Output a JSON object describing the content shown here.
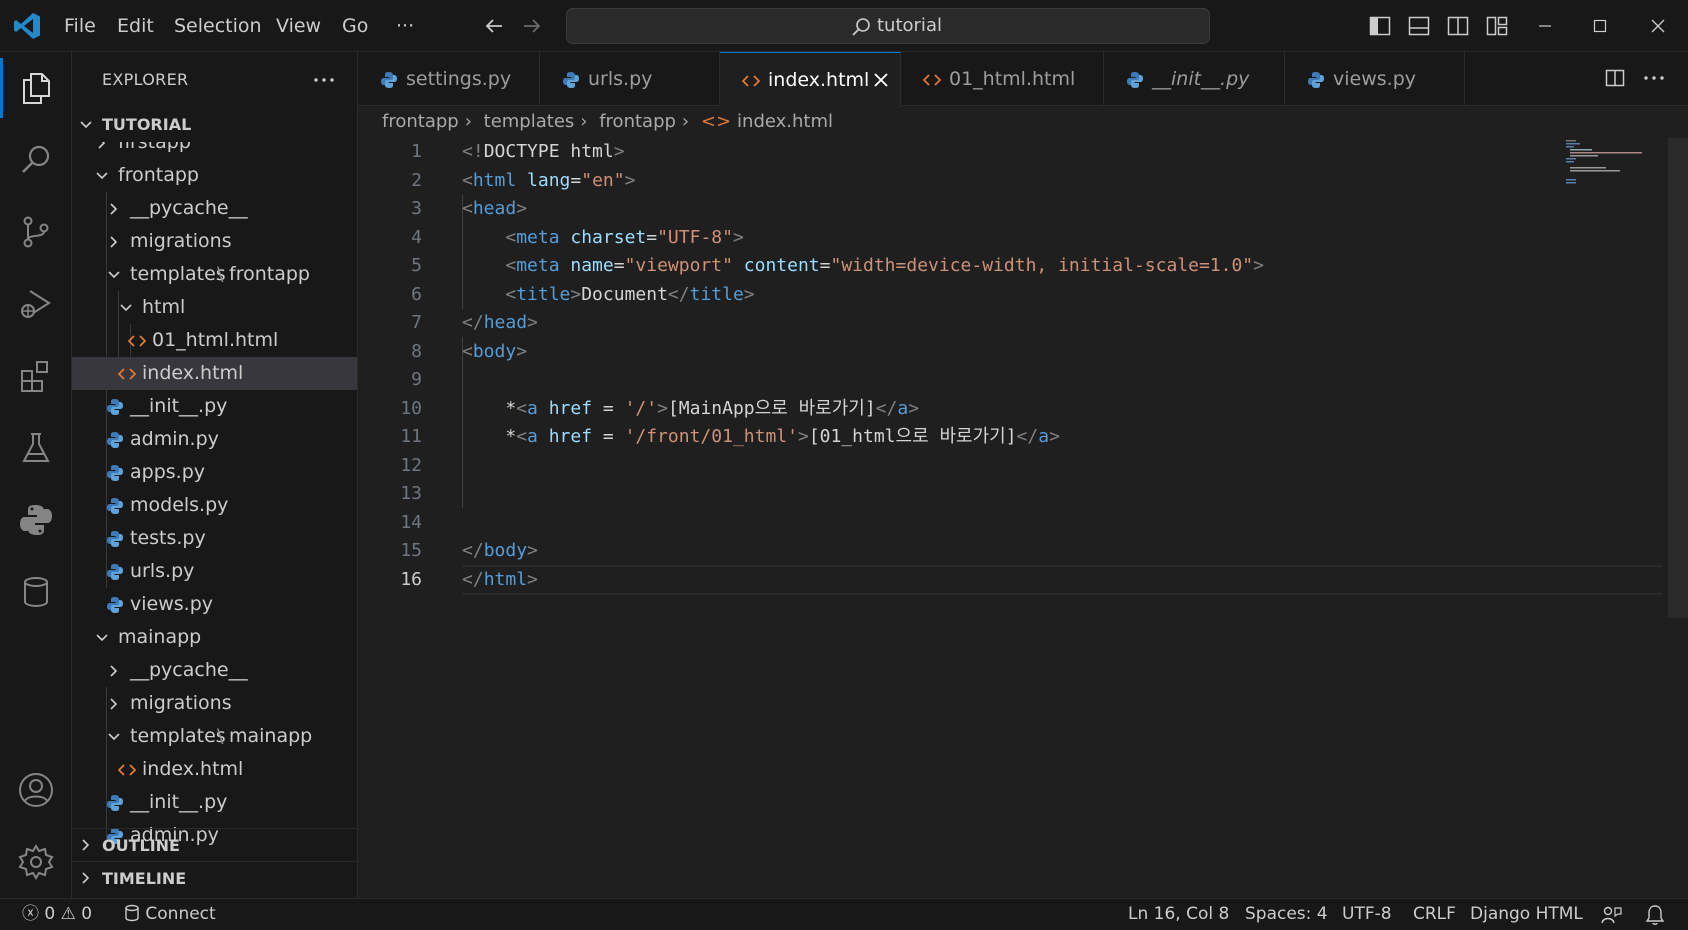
{
  "titlebar": {
    "menus": [
      "File",
      "Edit",
      "Selection",
      "View",
      "Go",
      "···"
    ],
    "search_text": "tutorial",
    "accent": "#0078d4"
  },
  "explorer": {
    "title": "EXPLORER",
    "section": "TUTORIAL",
    "tree": [
      {
        "label": "firstapp",
        "kind": "folder",
        "open": false,
        "depth": 1,
        "clipped": true
      },
      {
        "label": "frontapp",
        "kind": "folder",
        "open": true,
        "depth": 1
      },
      {
        "label": "__pycache__",
        "kind": "folder",
        "open": false,
        "depth": 2
      },
      {
        "label": "migrations",
        "kind": "folder",
        "open": false,
        "depth": 2
      },
      {
        "label": "templates",
        "label2": "frontapp",
        "kind": "folder",
        "open": true,
        "depth": 2
      },
      {
        "label": "html",
        "kind": "folder",
        "open": true,
        "depth": 3
      },
      {
        "label": "01_html.html",
        "kind": "html",
        "depth": 4
      },
      {
        "label": "index.html",
        "kind": "html",
        "depth": 3,
        "selected": true
      },
      {
        "label": "__init__.py",
        "kind": "py",
        "depth": 2
      },
      {
        "label": "admin.py",
        "kind": "py",
        "depth": 2
      },
      {
        "label": "apps.py",
        "kind": "py",
        "depth": 2
      },
      {
        "label": "models.py",
        "kind": "py",
        "depth": 2
      },
      {
        "label": "tests.py",
        "kind": "py",
        "depth": 2
      },
      {
        "label": "urls.py",
        "kind": "py",
        "depth": 2
      },
      {
        "label": "views.py",
        "kind": "py",
        "depth": 2
      },
      {
        "label": "mainapp",
        "kind": "folder",
        "open": true,
        "depth": 1
      },
      {
        "label": "__pycache__",
        "kind": "folder",
        "open": false,
        "depth": 2
      },
      {
        "label": "migrations",
        "kind": "folder",
        "open": false,
        "depth": 2
      },
      {
        "label": "templates",
        "label2": "mainapp",
        "kind": "folder",
        "open": true,
        "depth": 2
      },
      {
        "label": "index.html",
        "kind": "html",
        "depth": 3
      },
      {
        "label": "__init__.py",
        "kind": "py",
        "depth": 2
      },
      {
        "label": "admin.py",
        "kind": "py",
        "depth": 2
      }
    ],
    "outline": "OUTLINE",
    "timeline": "TIMELINE"
  },
  "tabs": [
    {
      "label": "settings.py",
      "kind": "py"
    },
    {
      "label": "urls.py",
      "kind": "py"
    },
    {
      "label": "index.html",
      "kind": "html",
      "active": true
    },
    {
      "label": "01_html.html",
      "kind": "html"
    },
    {
      "label": "__init__.py",
      "kind": "py",
      "italic": true
    },
    {
      "label": "views.py",
      "kind": "py"
    }
  ],
  "breadcrumb": [
    "frontapp",
    "templates",
    "frontapp",
    "index.html"
  ],
  "editor": {
    "current_line": 16,
    "lines": [
      [
        {
          "t": "<!",
          "c": "tagp"
        },
        {
          "t": "DOCTYPE",
          "c": "txt"
        },
        {
          "t": " html",
          "c": "txt"
        },
        {
          "t": ">",
          "c": "tagp"
        }
      ],
      [
        {
          "t": "<",
          "c": "tagp"
        },
        {
          "t": "html",
          "c": "tagn"
        },
        {
          "t": " lang",
          "c": "attr"
        },
        {
          "t": "=",
          "c": "txt"
        },
        {
          "t": "\"en\"",
          "c": "str"
        },
        {
          "t": ">",
          "c": "tagp"
        }
      ],
      [
        {
          "t": "<",
          "c": "tagp"
        },
        {
          "t": "head",
          "c": "tagn"
        },
        {
          "t": ">",
          "c": "tagp"
        }
      ],
      [
        {
          "t": "    <",
          "c": "tagp"
        },
        {
          "t": "meta",
          "c": "tagn"
        },
        {
          "t": " charset",
          "c": "attr"
        },
        {
          "t": "=",
          "c": "txt"
        },
        {
          "t": "\"UTF-8\"",
          "c": "str"
        },
        {
          "t": ">",
          "c": "tagp"
        }
      ],
      [
        {
          "t": "    <",
          "c": "tagp"
        },
        {
          "t": "meta",
          "c": "tagn"
        },
        {
          "t": " name",
          "c": "attr"
        },
        {
          "t": "=",
          "c": "txt"
        },
        {
          "t": "\"viewport\"",
          "c": "str"
        },
        {
          "t": " content",
          "c": "attr"
        },
        {
          "t": "=",
          "c": "txt"
        },
        {
          "t": "\"width=device-width, initial-scale=1.0\"",
          "c": "str"
        },
        {
          "t": ">",
          "c": "tagp"
        }
      ],
      [
        {
          "t": "    <",
          "c": "tagp"
        },
        {
          "t": "title",
          "c": "tagn"
        },
        {
          "t": ">",
          "c": "tagp"
        },
        {
          "t": "Document",
          "c": "txt"
        },
        {
          "t": "</",
          "c": "tagp"
        },
        {
          "t": "title",
          "c": "tagn"
        },
        {
          "t": ">",
          "c": "tagp"
        }
      ],
      [
        {
          "t": "</",
          "c": "tagp"
        },
        {
          "t": "head",
          "c": "tagn"
        },
        {
          "t": ">",
          "c": "tagp"
        }
      ],
      [
        {
          "t": "<",
          "c": "tagp"
        },
        {
          "t": "body",
          "c": "tagn"
        },
        {
          "t": ">",
          "c": "tagp"
        }
      ],
      [],
      [
        {
          "t": "    *",
          "c": "txt"
        },
        {
          "t": "<",
          "c": "tagp"
        },
        {
          "t": "a",
          "c": "tagn"
        },
        {
          "t": " href",
          "c": "attr"
        },
        {
          "t": " = ",
          "c": "txt"
        },
        {
          "t": "'/'",
          "c": "str"
        },
        {
          "t": ">",
          "c": "tagp"
        },
        {
          "t": "[MainApp으로 바로가기]",
          "c": "txt"
        },
        {
          "t": "</",
          "c": "tagp"
        },
        {
          "t": "a",
          "c": "tagn"
        },
        {
          "t": ">",
          "c": "tagp"
        }
      ],
      [
        {
          "t": "    *",
          "c": "txt"
        },
        {
          "t": "<",
          "c": "tagp"
        },
        {
          "t": "a",
          "c": "tagn"
        },
        {
          "t": " href",
          "c": "attr"
        },
        {
          "t": " = ",
          "c": "txt"
        },
        {
          "t": "'/front/01_html'",
          "c": "str"
        },
        {
          "t": ">",
          "c": "tagp"
        },
        {
          "t": "[01_html으로 바로가기]",
          "c": "txt"
        },
        {
          "t": "</",
          "c": "tagp"
        },
        {
          "t": "a",
          "c": "tagn"
        },
        {
          "t": ">",
          "c": "tagp"
        }
      ],
      [],
      [],
      [],
      [
        {
          "t": "</",
          "c": "tagp"
        },
        {
          "t": "body",
          "c": "tagn"
        },
        {
          "t": ">",
          "c": "tagp"
        }
      ],
      [
        {
          "t": "</",
          "c": "tagp"
        },
        {
          "t": "html",
          "c": "tagn"
        },
        {
          "t": ">",
          "c": "tagp"
        }
      ]
    ]
  },
  "status": {
    "errors": "0",
    "warnings": "0",
    "connect": "Connect",
    "position": "Ln 16, Col 8",
    "spaces": "Spaces: 4",
    "encoding": "UTF-8",
    "eol": "CRLF",
    "language": "Django HTML"
  }
}
